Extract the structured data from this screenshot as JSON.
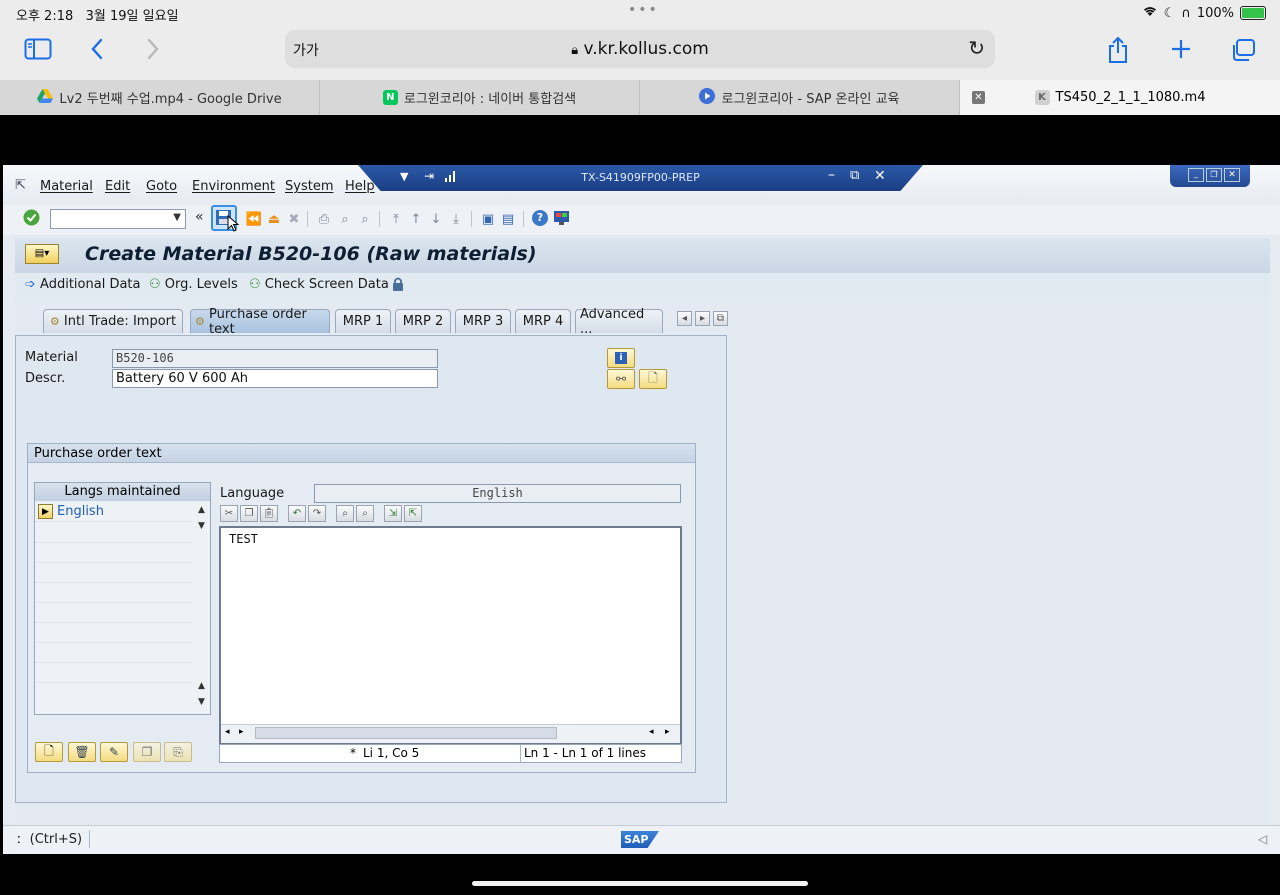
{
  "ios": {
    "time": "오후 2:18",
    "date": "3월 19일 일요일",
    "battery": "100%"
  },
  "safari": {
    "text_size": "가가",
    "url": "v.kr.kollus.com",
    "tabs": [
      {
        "label": "Lv2 두번째 수업.mp4 - Google Drive"
      },
      {
        "label": "로그윈코리아 : 네이버 통합검색"
      },
      {
        "label": "로그윈코리아 - SAP 온라인 교육"
      },
      {
        "label": "TS450_2_1_1_1080.m4"
      }
    ],
    "favicons": {
      "naver": "N",
      "kollus": "K"
    },
    "colors": {
      "accent": "#1a6fe8"
    }
  },
  "sap": {
    "menu": [
      "Material",
      "Edit",
      "Goto",
      "Environment",
      "System",
      "Help"
    ],
    "system_id": "TX-S41909FP00-PREP",
    "title": "Create Material B520-106 (Raw materials)",
    "app_toolbar": {
      "additional_data": "Additional Data",
      "org_levels": "Org. Levels",
      "check_screen_data": "Check Screen Data"
    },
    "tabs": [
      {
        "label": "Intl Trade: Import"
      },
      {
        "label": "Purchase order text"
      },
      {
        "label": "MRP 1"
      },
      {
        "label": "MRP 2"
      },
      {
        "label": "MRP 3"
      },
      {
        "label": "MRP 4"
      },
      {
        "label": "Advanced ..."
      }
    ],
    "fields": {
      "material_label": "Material",
      "material_value": "B520-106",
      "descr_label": "Descr.",
      "descr_value": "Battery 60 V 600 Ah"
    },
    "po_text": {
      "group_title": "Purchase order text",
      "langs_header": "Langs maintained",
      "langs": [
        "English"
      ],
      "language_label": "Language",
      "language_value": "English",
      "editor_text": "TEST",
      "status_mark": "*",
      "status_pos": "Li 1, Co 5",
      "status_lines": "Ln 1 - Ln 1 of 1 lines"
    },
    "statusbar": {
      "text": "(Ctrl+S)",
      "logo": "SAP"
    }
  }
}
